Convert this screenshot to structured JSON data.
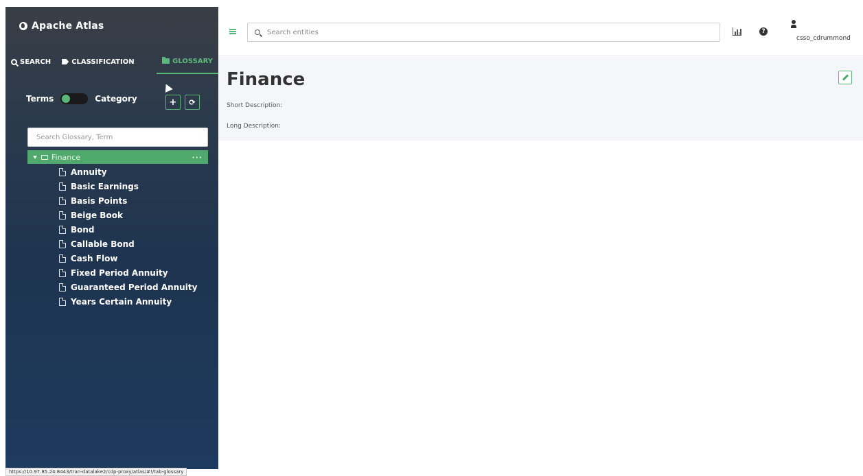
{
  "app": {
    "title": "Apache Atlas"
  },
  "sidebar": {
    "tabs": [
      {
        "label": "SEARCH"
      },
      {
        "label": "CLASSIFICATION"
      },
      {
        "label": "GLOSSARY"
      }
    ],
    "toggle": {
      "left_label": "Terms",
      "right_label": "Category"
    },
    "add_label": "+",
    "refresh_label": "⟳",
    "search": {
      "placeholder": "Search Glossary, Term"
    },
    "tree": {
      "root_label": "Finance",
      "more_label": "···",
      "terms": [
        "Annuity",
        "Basic Earnings",
        "Basis Points",
        "Beige Book",
        "Bond",
        "Callable Bond",
        "Cash Flow",
        "Fixed Period Annuity",
        "Guaranteed Period Annuity",
        "Years Certain Annuity"
      ]
    }
  },
  "header": {
    "search": {
      "placeholder": "Search entities"
    },
    "help_label": "?",
    "user": {
      "name": "csso_cdrummond"
    }
  },
  "main": {
    "title": "Finance",
    "short_description_label": "Short Description:",
    "long_description_label": "Long Description:"
  },
  "status_bar": {
    "url": "https://10.97.85.24:8443/tran-datalake2/cdp-proxy/atlas/#!/tab-glossary"
  },
  "colors": {
    "accent": "#5cb87a",
    "sidebar_top": "#3a3e45",
    "sidebar_bottom": "#1d3b5e"
  },
  "icons": [
    "globe-icon",
    "search-icon",
    "tag-icon",
    "folder-icon",
    "plus-icon",
    "refresh-icon",
    "file-icon",
    "menu-icon",
    "chart-icon",
    "help-icon",
    "user-icon",
    "edit-icon"
  ]
}
